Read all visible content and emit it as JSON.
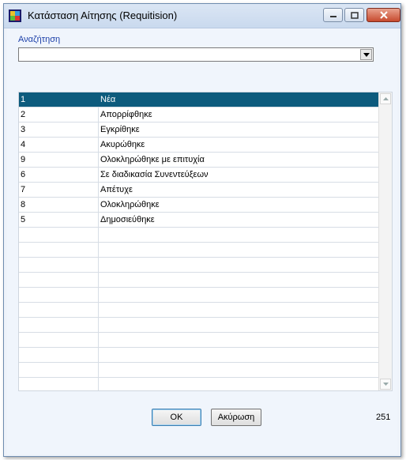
{
  "window": {
    "title": "Κατάσταση Αίτησης (Requitision)"
  },
  "search": {
    "label": "Αναζήτηση",
    "value": ""
  },
  "grid": {
    "rows": [
      {
        "code": "1",
        "name": "Νέα"
      },
      {
        "code": "2",
        "name": "Απορρίφθηκε"
      },
      {
        "code": "3",
        "name": "Εγκρίθηκε"
      },
      {
        "code": "4",
        "name": "Ακυρώθηκε"
      },
      {
        "code": "9",
        "name": "Ολοκληρώθηκε με επιτυχία"
      },
      {
        "code": "6",
        "name": "Σε διαδικασία Συνεντεύξεων"
      },
      {
        "code": "7",
        "name": "Απέτυχε"
      },
      {
        "code": "8",
        "name": "Ολοκληρώθηκε"
      },
      {
        "code": "5",
        "name": "Δημοσιεύθηκε"
      }
    ]
  },
  "buttons": {
    "ok": "OK",
    "cancel": "Ακύρωση"
  },
  "footer": {
    "count": "251"
  },
  "colors": {
    "selection": "#0d5b7d",
    "label": "#1a3ea8"
  }
}
